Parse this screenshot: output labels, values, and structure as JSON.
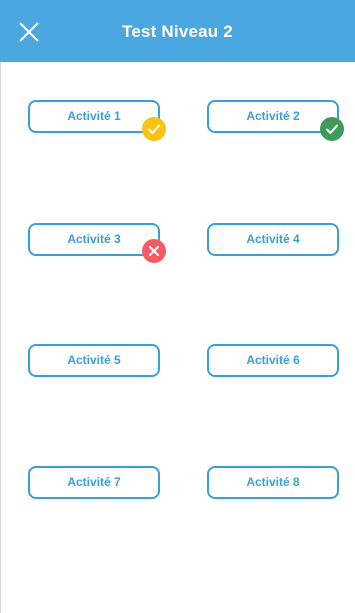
{
  "header": {
    "title": "Test Niveau 2",
    "close_icon": "close-icon"
  },
  "activities": [
    {
      "label": "Activité 1",
      "status": "pending",
      "badge_color": "#f7c314"
    },
    {
      "label": "Activité 2",
      "status": "success",
      "badge_color": "#3f9a5b"
    },
    {
      "label": "Activité 3",
      "status": "failed",
      "badge_color": "#f35c63"
    },
    {
      "label": "Activité 4",
      "status": "none"
    },
    {
      "label": "Activité 5",
      "status": "none"
    },
    {
      "label": "Activité 6",
      "status": "none"
    },
    {
      "label": "Activité 7",
      "status": "none"
    },
    {
      "label": "Activité 8",
      "status": "none"
    }
  ],
  "colors": {
    "header_bg": "#4aa7e0",
    "accent": "#3a9fd9"
  }
}
